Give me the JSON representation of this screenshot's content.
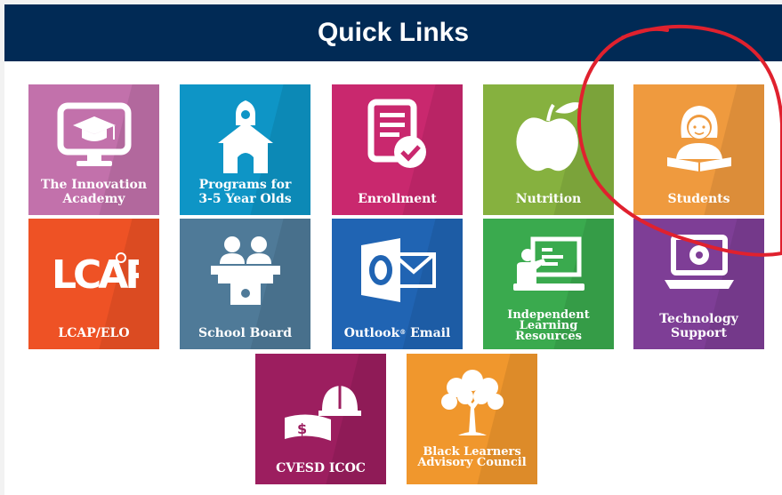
{
  "header": {
    "title": "Quick Links"
  },
  "tiles": [
    {
      "label": "The Innovation\nAcademy",
      "color": "#c271ab",
      "icon": "monitor-graduation-cap-icon"
    },
    {
      "label": "Programs for\n3-5 Year Olds",
      "color": "#0e95c6",
      "icon": "schoolhouse-icon"
    },
    {
      "label": "Enrollment",
      "color": "#c9286e",
      "icon": "form-checkmark-icon"
    },
    {
      "label": "Nutrition",
      "color": "#86b13f",
      "icon": "apple-icon"
    },
    {
      "label": "Students",
      "color": "#ef9a3e",
      "icon": "student-reading-icon"
    },
    {
      "label": "LCAP/ELO",
      "color": "#ee5225",
      "icon": "lcap-logo-icon"
    },
    {
      "label": "School Board",
      "color": "#4f7a98",
      "icon": "board-members-icon"
    },
    {
      "label": "Outlook",
      "label_suffix": "Email",
      "trademark": "®",
      "color": "#2064b3",
      "icon": "outlook-envelope-icon"
    },
    {
      "label": "Independent\nLearning\nResources",
      "color": "#3aaa4e",
      "icon": "teacher-whiteboard-icon"
    },
    {
      "label": "Technology\nSupport",
      "color": "#7e3e96",
      "icon": "laptop-gear-icon"
    },
    {
      "label": "CVESD ICOC",
      "color": "#9c1e5f",
      "icon": "hardhat-money-icon"
    },
    {
      "label": "Black Learners\nAdvisory Council",
      "color": "#f0972d",
      "icon": "tree-icon"
    }
  ],
  "annotation": {
    "color": "#e0212e",
    "icon": "hand-drawn-circle-annotation"
  }
}
